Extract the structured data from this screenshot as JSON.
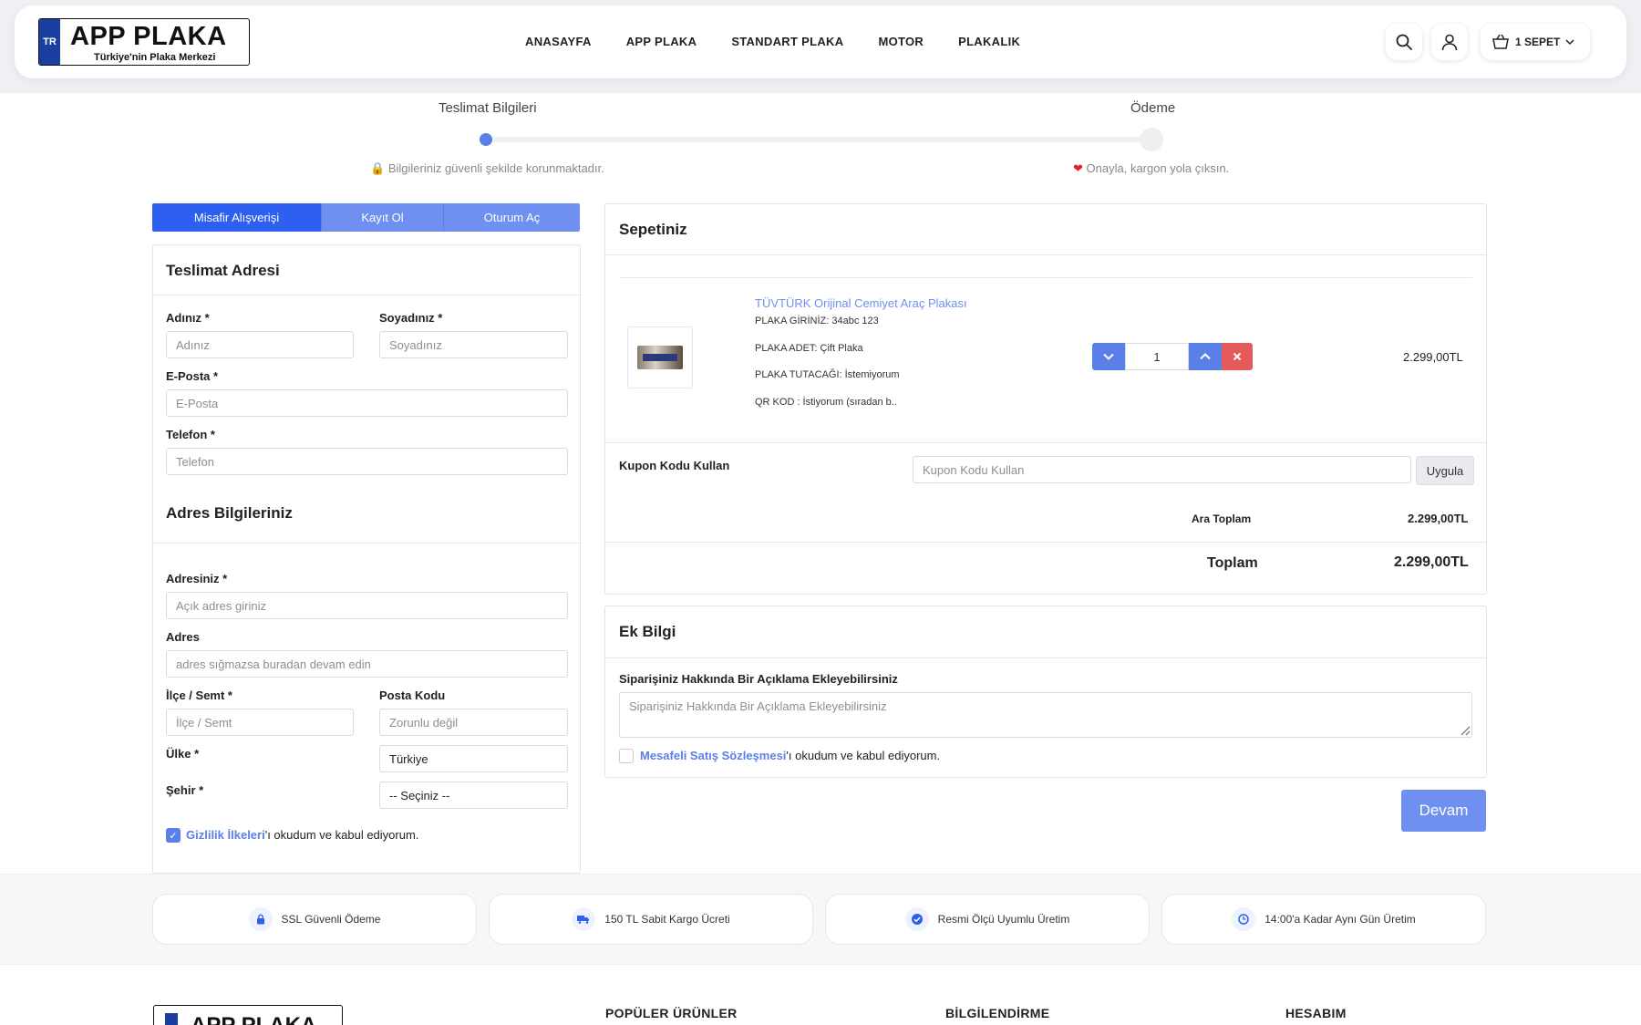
{
  "header": {
    "logo_tr": "TR",
    "logo_main": "APP PLAKA",
    "logo_sub": "Türkiye'nin Plaka Merkezi",
    "nav": [
      "ANASAYFA",
      "APP PLAKA",
      "STANDART PLAKA",
      "MOTOR",
      "PLAKALIK"
    ],
    "cart_label": "1 SEPET"
  },
  "steps": {
    "step1": "Teslimat Bilgileri",
    "step2": "Ödeme",
    "note1": "Bilgileriniz güvenli şekilde korunmaktadır.",
    "note2": "Onayla, kargon yola çıksın.",
    "progress": 0.0
  },
  "tabs": [
    "Misafir Alışverişi",
    "Kayıt Ol",
    "Oturum Aç"
  ],
  "delivery": {
    "title": "Teslimat Adresi",
    "ad_label": "Adınız *",
    "ad_ph": "Adınız",
    "soyad_label": "Soyadınız *",
    "soyad_ph": "Soyadınız",
    "eposta_label": "E-Posta *",
    "eposta_ph": "E-Posta",
    "telefon_label": "Telefon *",
    "telefon_ph": "Telefon",
    "addr_title": "Adres Bilgileriniz",
    "adres1_label": "Adresiniz *",
    "adres1_ph": "Açık adres giriniz",
    "adres2_label": "Adres",
    "adres2_ph": "adres sığmazsa buradan devam edin",
    "ilce_label": "İlçe / Semt *",
    "ilce_ph": "İlçe / Semt",
    "posta_label": "Posta Kodu",
    "posta_ph": "Zorunlu değil",
    "ulke_label": "Ülke *",
    "ulke_val": "Türkiye",
    "sehir_label": "Şehir *",
    "sehir_val": "-- Seçiniz --",
    "privacy_link": "Gizlilik İlkeleri",
    "privacy_rest": "'ı okudum ve kabul ediyorum."
  },
  "cart": {
    "title": "Sepetiniz",
    "item_name": "TÜVTÜRK Orijinal Cemiyet Araç Plakası",
    "attrs": [
      "PLAKA GİRİNİZ: 34abc 123",
      "PLAKA ADET: Çift Plaka",
      "PLAKA TUTACAĞI: İstemiyorum",
      "QR KOD : İstiyorum (sıradan b.."
    ],
    "qty": "1",
    "item_price": "2.299,00TL",
    "coupon_label": "Kupon Kodu Kullan",
    "coupon_ph": "Kupon Kodu Kullan",
    "apply": "Uygula",
    "subtotal_label": "Ara Toplam",
    "subtotal": "2.299,00TL",
    "total_label": "Toplam",
    "total": "2.299,00TL"
  },
  "extra": {
    "title": "Ek Bilgi",
    "note_label": "Siparişiniz Hakkında Bir Açıklama Ekleyebilirsiniz",
    "note_ph": "Siparişiniz Hakkında Bir Açıklama Ekleyebilirsiniz",
    "contract_link": "Mesafeli Satış Sözleşmesi",
    "contract_rest": "'ı okudum ve kabul ediyorum."
  },
  "continue": "Devam",
  "features": [
    "SSL Güvenli Ödeme",
    "150 TL Sabit Kargo Ücreti",
    "Resmi Ölçü Uyumlu Üretim",
    "14:00'a Kadar Aynı Gün Üretim"
  ],
  "footer": {
    "logo_main": "APP PLAKA",
    "h1": "POPÜLER ÜRÜNLER",
    "h2": "BİLGİLENDİRME",
    "h3": "HESABIM"
  },
  "colors": {
    "accent": "#2d5ff0",
    "accent_light": "#6f90f0",
    "remove": "#e55a5a"
  }
}
